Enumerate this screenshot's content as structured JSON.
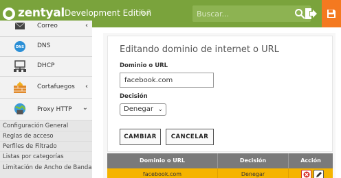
{
  "header": {
    "brand": "zentyal",
    "edition": "Development Edition",
    "version": "6.2",
    "search_placeholder": "Buscar...",
    "colors": {
      "bar": "#7aa33c",
      "save": "#f47920"
    }
  },
  "sidebar": {
    "items": [
      {
        "label": "Correo",
        "icon": "mail-icon",
        "chevron": "‹"
      },
      {
        "label": "DNS",
        "icon": "dns-icon",
        "chevron": ""
      },
      {
        "label": "DHCP",
        "icon": "dhcp-icon",
        "chevron": ""
      },
      {
        "label": "Cortafuegos",
        "icon": "firewall-icon",
        "chevron": "‹"
      },
      {
        "label": "Proxy HTTP",
        "icon": "proxy-icon",
        "chevron": "⌄"
      }
    ],
    "subitems": [
      "Configuración General",
      "Reglas de acceso",
      "Perfiles de Filtrado",
      "Listas por categorías",
      "Limitación de Ancho de Banda"
    ]
  },
  "form": {
    "title": "Editando dominio de internet o URL",
    "domain_label": "Dominio o URL",
    "domain_value": "facebook.com",
    "decision_label": "Decisión",
    "decision_value": "Denegar",
    "change_button": "CAMBIAR",
    "cancel_button": "CANCELAR"
  },
  "table": {
    "columns": [
      "Dominio o URL",
      "Decisión",
      "Acción"
    ],
    "rows": [
      {
        "domain": "facebook.com",
        "decision": "Denegar"
      }
    ],
    "highlight_color": "#f5b400"
  }
}
